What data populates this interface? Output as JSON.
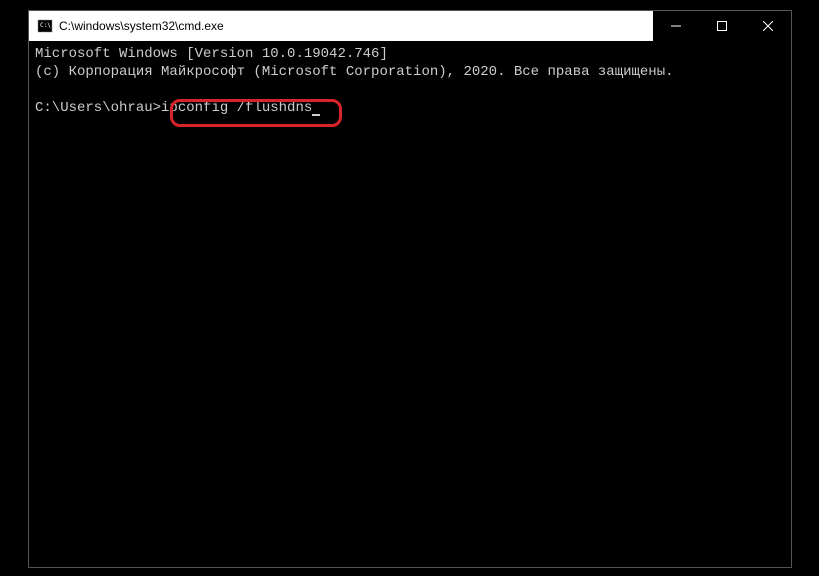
{
  "window": {
    "title": "C:\\windows\\system32\\cmd.exe"
  },
  "terminal": {
    "line1": "Microsoft Windows [Version 10.0.19042.746]",
    "line2": "(c) Корпорация Майкрософт (Microsoft Corporation), 2020. Все права защищены.",
    "prompt": "C:\\Users\\ohrau>",
    "command": "ipconfig /flushdns"
  }
}
